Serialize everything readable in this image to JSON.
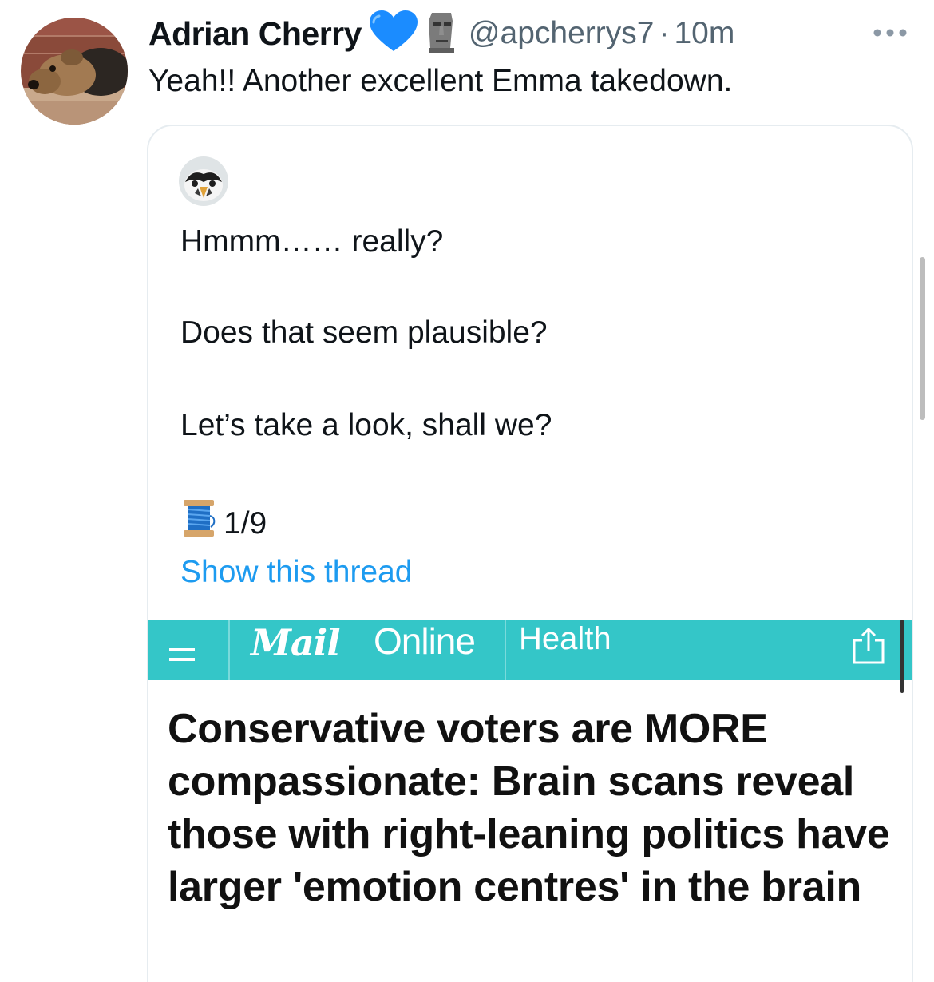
{
  "tweet": {
    "author_name": "Adrian Cherry",
    "author_badges": [
      "blue-heart-emoji",
      "moai-emoji"
    ],
    "handle": "@apcherrys7",
    "separator": "·",
    "time": "10m",
    "text": "Yeah!! Another excellent Emma takedown."
  },
  "quoted_tweet": {
    "lines": [
      "Hmmm…… really?",
      "Does that seem plausible?",
      "Let’s take a look, shall we?"
    ],
    "thread_counter": "1/9",
    "thread_emoji": "spool-of-thread-emoji",
    "show_thread_label": "Show this thread",
    "embedded_screenshot": {
      "logo_primary": "Mail",
      "logo_secondary": "Online",
      "section": "Health",
      "headline": "Conservative voters are MORE compassionate: Brain scans reveal those with right-leaning politics have larger 'emotion centres' in the brain",
      "bar_color": "#34c6c8"
    }
  },
  "colors": {
    "text": "#0f1419",
    "secondary_text": "#536471",
    "link": "#1d9bf0",
    "card_border": "#e6ecf0"
  }
}
